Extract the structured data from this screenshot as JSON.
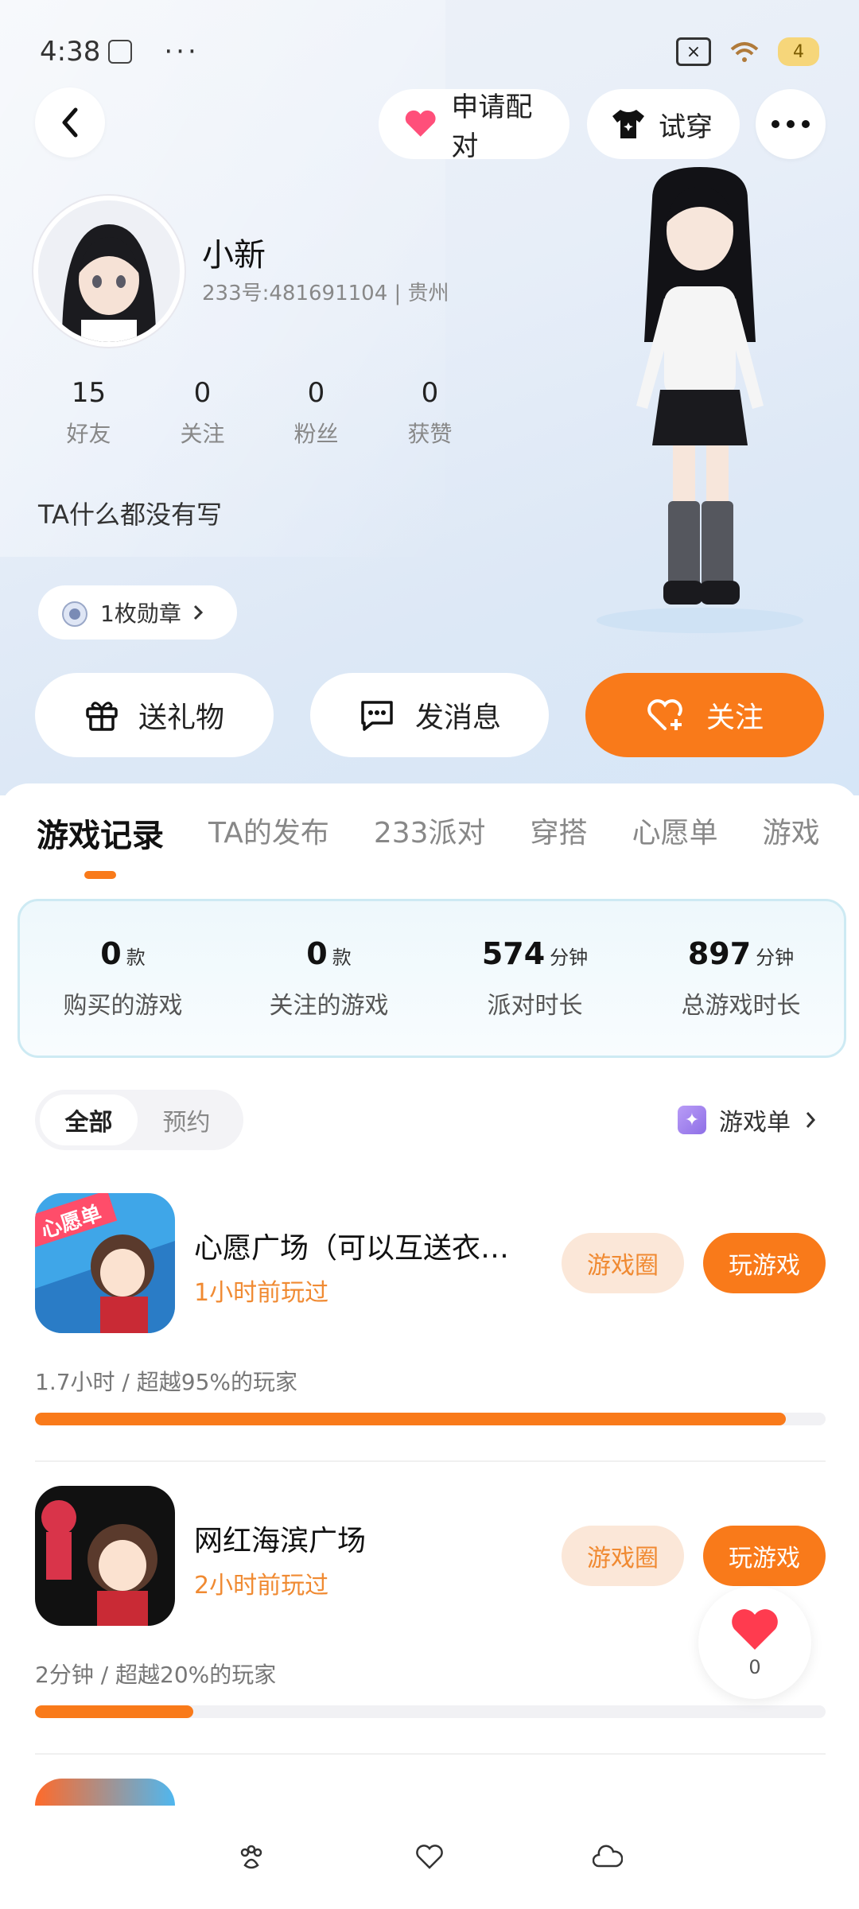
{
  "status_bar": {
    "time": "4:38",
    "dots": "···",
    "battery": "4"
  },
  "header": {
    "match_label": "申请配对",
    "tryon_label": "试穿"
  },
  "profile": {
    "name": "小新",
    "meta": "233号:481691104 | 贵州",
    "stats": [
      {
        "value": "15",
        "label": "好友"
      },
      {
        "value": "0",
        "label": "关注"
      },
      {
        "value": "0",
        "label": "粉丝"
      },
      {
        "value": "0",
        "label": "获赞"
      }
    ],
    "bio": "TA什么都没有写",
    "badge_label": "1枚勋章"
  },
  "actions": {
    "gift": "送礼物",
    "message": "发消息",
    "follow": "关注"
  },
  "tabs": [
    "游戏记录",
    "TA的发布",
    "233派对",
    "穿搭",
    "心愿单",
    "游戏"
  ],
  "summary": [
    {
      "value": "0",
      "unit": "款",
      "label": "购买的游戏"
    },
    {
      "value": "0",
      "unit": "款",
      "label": "关注的游戏"
    },
    {
      "value": "574",
      "unit": "分钟",
      "label": "派对时长"
    },
    {
      "value": "897",
      "unit": "分钟",
      "label": "总游戏时长"
    }
  ],
  "filter": {
    "all": "全部",
    "reserve": "预约",
    "gamelist": "游戏单"
  },
  "games": [
    {
      "title": "心愿广场（可以互送衣…",
      "subtitle": "1小时前玩过",
      "circle_label": "游戏圈",
      "play_label": "玩游戏",
      "stat": "1.7小时 / 超越95%的玩家",
      "progress": 0.95,
      "icon_tag": "心愿单"
    },
    {
      "title": "网红海滨广场",
      "subtitle": "2小时前玩过",
      "circle_label": "游戏圈",
      "play_label": "玩游戏",
      "stat": "2分钟 / 超越20%的玩家",
      "progress": 0.2
    }
  ],
  "like": {
    "count": "0"
  },
  "colors": {
    "accent": "#f97a1a",
    "accent_soft": "#fbe7d8"
  }
}
